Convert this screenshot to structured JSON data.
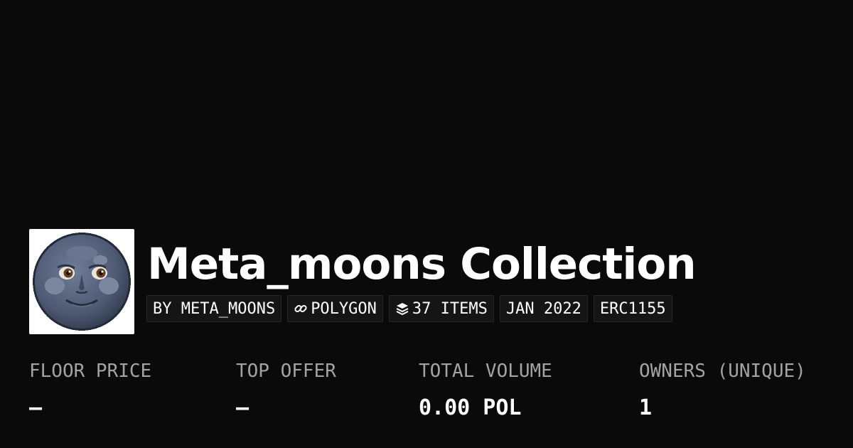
{
  "collection": {
    "title": "Meta_moons Collection",
    "avatar_icon": "full-moon-face-icon"
  },
  "badges": [
    {
      "label": "BY META_MOONS",
      "icon": null
    },
    {
      "label": "POLYGON",
      "icon": "chain-link-icon"
    },
    {
      "label": "37 ITEMS",
      "icon": "layers-icon"
    },
    {
      "label": "JAN 2022",
      "icon": null
    },
    {
      "label": "ERC1155",
      "icon": null
    }
  ],
  "stats": [
    {
      "label": "FLOOR PRICE",
      "value": "–"
    },
    {
      "label": "TOP OFFER",
      "value": "–"
    },
    {
      "label": "TOTAL VOLUME",
      "value": "0.00 POL"
    },
    {
      "label": "OWNERS (UNIQUE)",
      "value": "1"
    }
  ],
  "colors": {
    "background": "#0a0a0a",
    "text": "#ffffff",
    "muted_text": "#a3a3a3",
    "badge_bg": "#151515",
    "badge_border": "#262626"
  }
}
